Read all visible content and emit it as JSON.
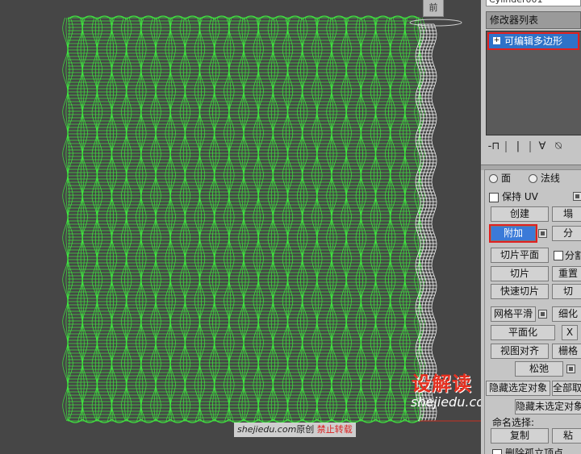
{
  "viewport": {
    "view_label": "前",
    "watermark_host": "shejiedu.com",
    "watermark_mid": "原创",
    "watermark_warn": "禁止转载",
    "brand_name": "设解读",
    "brand_url": "shejiedu.com",
    "mesh_color": "#3fe23f",
    "selected_color": "#ffffff"
  },
  "panel": {
    "object_name": "Cylinder001",
    "modifier_list": "修改器列表",
    "stack_item": "可编辑多边形",
    "stack_item_toggle": "+",
    "tools": [
      "-⊓",
      "|",
      "∀",
      "⍉"
    ],
    "radio_face": "面",
    "radio_normal": "法线",
    "preserve_uv": "保持 UV",
    "create": "创建",
    "collapse": "塌",
    "attach": "附加",
    "detach": "分",
    "slice_plane": "切片平面",
    "split": "分割",
    "slice": "切片",
    "reset_plane": "重置",
    "quickslice": "快速切片",
    "cut": "切",
    "meshsmooth": "网格平滑",
    "tessellate": "细化",
    "make_planar": "平面化",
    "x": "X",
    "view_align": "视图对齐",
    "grid_align": "栅格",
    "relax": "松弛",
    "hide_selected": "隐藏选定对象",
    "unhide_all": "全部取消",
    "hide_unselected": "隐藏未选定对象",
    "named_selections": "命名选择:",
    "copy": "复制",
    "paste": "粘",
    "delete_isolated": "删除孤立顶点"
  }
}
